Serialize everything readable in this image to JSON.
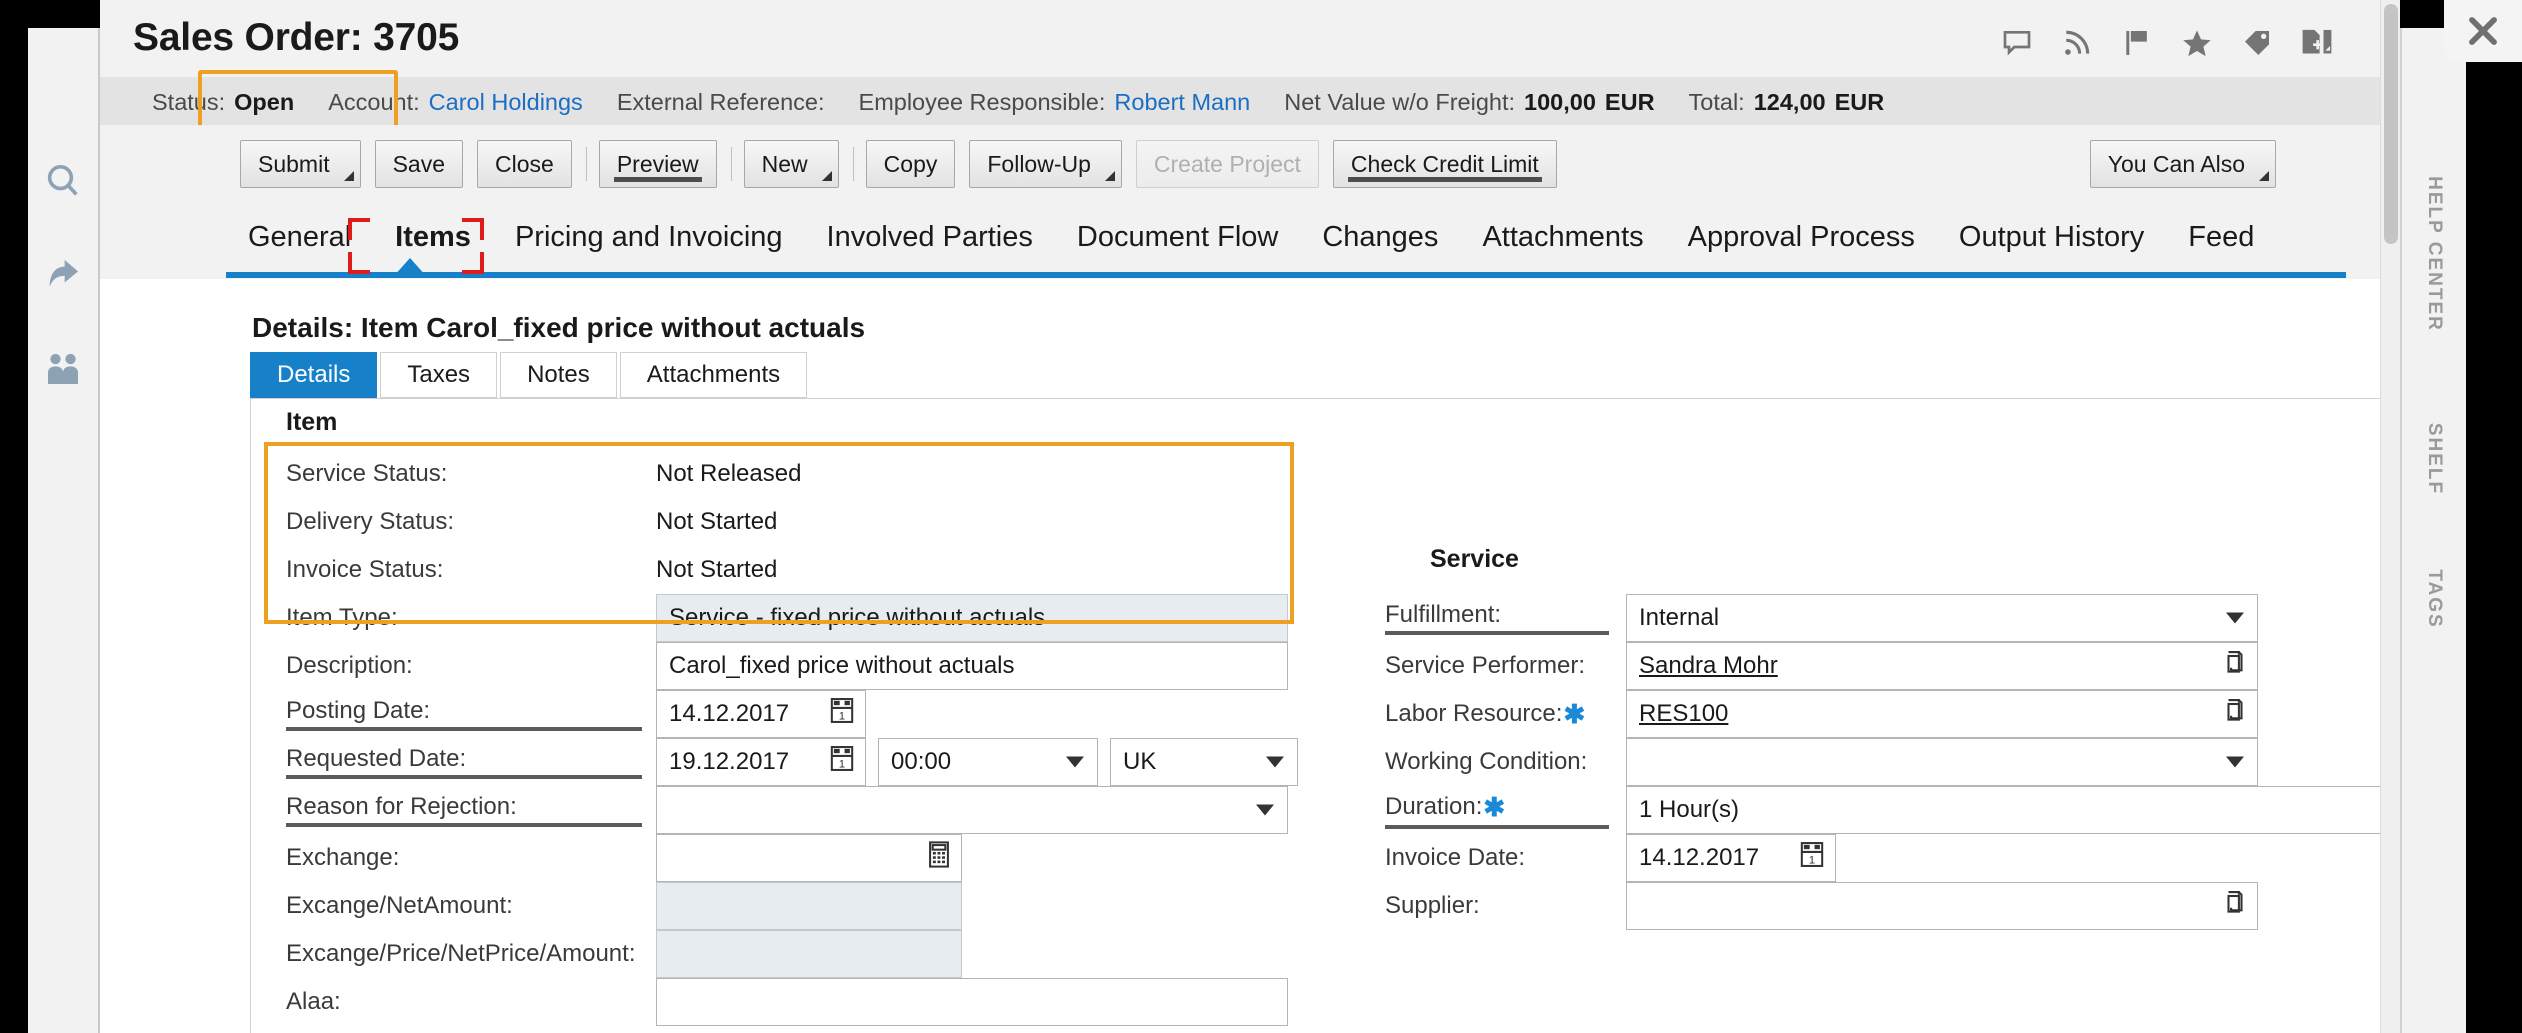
{
  "window": {
    "close_label": "✕"
  },
  "left_rail": {
    "items": [
      {
        "name": "search-icon",
        "label": "Search"
      },
      {
        "name": "share-icon",
        "label": "Share"
      },
      {
        "name": "people-icon",
        "label": "People"
      }
    ]
  },
  "right_rail": {
    "items": [
      {
        "label": "HELP CENTER"
      },
      {
        "label": "SHELF"
      },
      {
        "label": "TAGS"
      }
    ]
  },
  "header": {
    "title": "Sales Order: 3705",
    "icons": [
      {
        "name": "comment-icon",
        "label": "Comment"
      },
      {
        "name": "rss-feed-icon",
        "label": "Feed"
      },
      {
        "name": "flag-icon",
        "label": "Flag"
      },
      {
        "name": "star-icon",
        "label": "Favorite"
      },
      {
        "name": "tag-icon",
        "label": "Tag"
      },
      {
        "name": "add-document-icon",
        "label": "Add to Shelf"
      }
    ]
  },
  "status_bar": {
    "fields": [
      {
        "label": "Status:",
        "value": "Open",
        "type": "bold"
      },
      {
        "label": "Account:",
        "value": "Carol Holdings",
        "type": "link"
      },
      {
        "label": "External Reference:",
        "value": "",
        "type": "text"
      },
      {
        "label": "Employee Responsible:",
        "value": "Robert Mann",
        "type": "link"
      },
      {
        "label": "Net Value w/o Freight:",
        "value": "100,00",
        "unit": "EUR",
        "type": "bold"
      },
      {
        "label": "Total:",
        "value": "124,00",
        "unit": "EUR",
        "type": "bold"
      }
    ],
    "highlight_color": "#eda022"
  },
  "toolbar": {
    "buttons": [
      {
        "label": "Submit",
        "caret": true,
        "disabled": false,
        "underbar": false
      },
      {
        "label": "Save",
        "caret": false,
        "disabled": false,
        "underbar": false
      },
      {
        "label": "Close",
        "caret": false,
        "disabled": false,
        "underbar": false
      },
      {
        "label": "Preview",
        "caret": false,
        "disabled": false,
        "underbar": true
      },
      {
        "label": "New",
        "caret": true,
        "disabled": false,
        "underbar": false
      },
      {
        "label": "Copy",
        "caret": false,
        "disabled": false,
        "underbar": false
      },
      {
        "label": "Follow-Up",
        "caret": true,
        "disabled": false,
        "underbar": false
      },
      {
        "label": "Create Project",
        "caret": false,
        "disabled": true,
        "underbar": false
      },
      {
        "label": "Check Credit Limit",
        "caret": false,
        "disabled": false,
        "underbar": true
      }
    ],
    "you_can_also_label": "You Can Also"
  },
  "tabs": {
    "items": [
      {
        "label": "General",
        "active": false
      },
      {
        "label": "Items",
        "active": true
      },
      {
        "label": "Pricing and Invoicing",
        "active": false
      },
      {
        "label": "Involved Parties",
        "active": false
      },
      {
        "label": "Document Flow",
        "active": false
      },
      {
        "label": "Changes",
        "active": false
      },
      {
        "label": "Attachments",
        "active": false
      },
      {
        "label": "Approval Process",
        "active": false
      },
      {
        "label": "Output History",
        "active": false
      },
      {
        "label": "Feed",
        "active": false
      }
    ],
    "accent_color": "#1681c8",
    "marker_color": "#e01b1b"
  },
  "details": {
    "title": "Details: Item Carol_fixed price without actuals",
    "subtabs": [
      {
        "label": "Details",
        "active": true
      },
      {
        "label": "Taxes",
        "active": false
      },
      {
        "label": "Notes",
        "active": false
      },
      {
        "label": "Attachments",
        "active": false
      }
    ]
  },
  "item_section": {
    "heading": "Item",
    "service_status": {
      "label": "Service Status:",
      "value": "Not Released"
    },
    "delivery_status": {
      "label": "Delivery Status:",
      "value": "Not Started"
    },
    "invoice_status": {
      "label": "Invoice Status:",
      "value": "Not Started"
    },
    "item_type": {
      "label": "Item Type:",
      "value": "Service - fixed price without actuals"
    },
    "description": {
      "label": "Description:",
      "value": "Carol_fixed price without actuals"
    },
    "posting_date": {
      "label": "Posting Date:",
      "value": "14.12.2017"
    },
    "requested_date": {
      "label": "Requested Date:",
      "value": "19.12.2017",
      "time": "00:00",
      "zone": "UK"
    },
    "reason_for_rejection": {
      "label": "Reason for Rejection:",
      "value": ""
    },
    "exchange": {
      "label": "Exchange:",
      "value": ""
    },
    "exchange_net_amount": {
      "label": "Excange/NetAmount:",
      "value": ""
    },
    "exchange_price_net_price_amount": {
      "label": "Excange/Price/NetPrice/Amount:",
      "value": ""
    },
    "alaa": {
      "label": "Alaa:",
      "value": ""
    }
  },
  "service_section": {
    "heading": "Service",
    "fulfillment": {
      "label": "Fulfillment:",
      "value": "Internal"
    },
    "service_performer": {
      "label": "Service Performer:",
      "value": "Sandra Mohr"
    },
    "labor_resource": {
      "label": "Labor Resource:",
      "value": "RES100",
      "required": true
    },
    "working_condition": {
      "label": "Working Condition:",
      "value": ""
    },
    "duration": {
      "label": "Duration:",
      "value": "1 Hour(s)",
      "required": true
    },
    "invoice_date": {
      "label": "Invoice Date:",
      "value": "14.12.2017"
    },
    "supplier": {
      "label": "Supplier:",
      "value": ""
    }
  }
}
